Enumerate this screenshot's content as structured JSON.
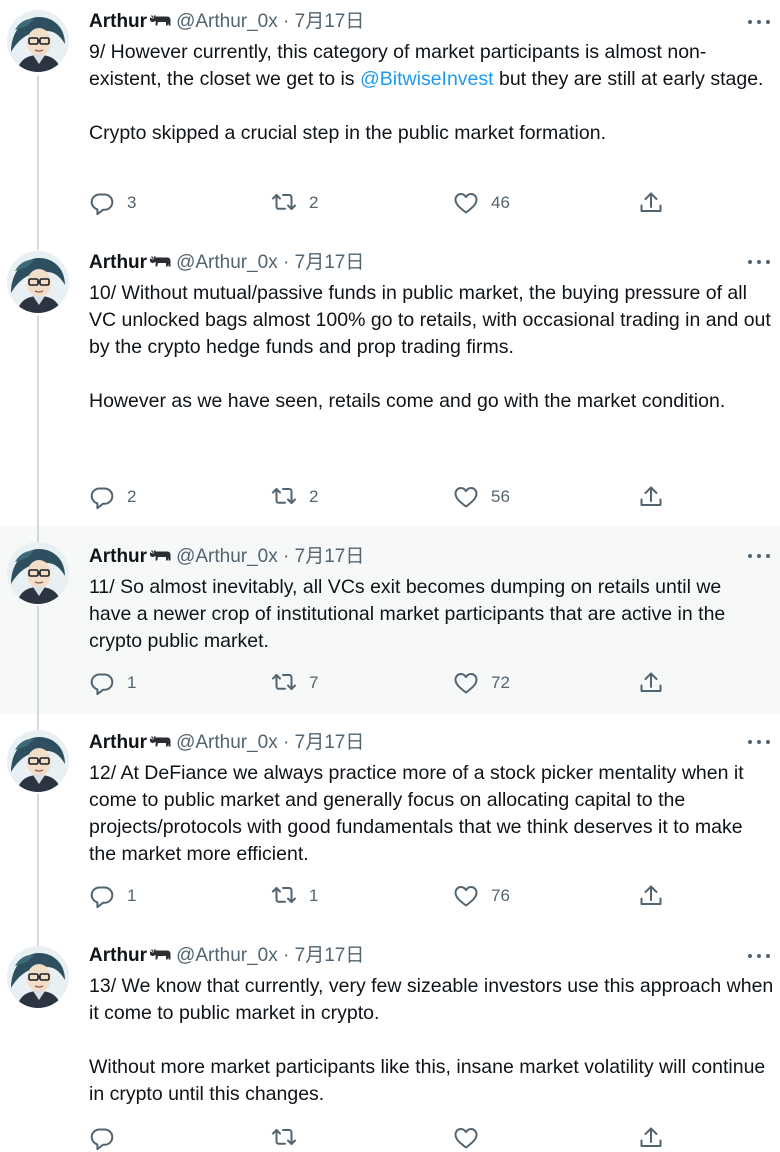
{
  "tweets": [
    {
      "name": "Arthur",
      "handle": "@Arthur_0x",
      "separator": "·",
      "date": "7月17日",
      "text_before": "9/ However currently, this category of market participants is almost non-existent, the closet we get to is ",
      "mention": "@BitwiseInvest",
      "text_after": " but they are still at early stage.\n\nCrypto skipped a crucial step in the public market formation.",
      "replies": "3",
      "retweets": "2",
      "likes": "46"
    },
    {
      "name": "Arthur",
      "handle": "@Arthur_0x",
      "separator": "·",
      "date": "7月17日",
      "text": "10/ Without mutual/passive funds in public market, the buying pressure of all VC unlocked bags almost 100% go to retails, with occasional trading in and out by the crypto hedge funds and prop trading firms.\n\nHowever as we have seen, retails come and go with the market condition.",
      "replies": "2",
      "retweets": "2",
      "likes": "56"
    },
    {
      "name": "Arthur",
      "handle": "@Arthur_0x",
      "separator": "·",
      "date": "7月17日",
      "text": "11/ So almost inevitably, all VCs exit becomes dumping on retails until we  have a newer crop of institutional market participants that are active in the crypto public market.",
      "replies": "1",
      "retweets": "7",
      "likes": "72"
    },
    {
      "name": "Arthur",
      "handle": "@Arthur_0x",
      "separator": "·",
      "date": "7月17日",
      "text": "12/ At DeFiance we always practice more of a stock picker mentality when it come to public market and generally focus on allocating capital to the projects/protocols with good fundamentals that we think deserves it to make the market more efficient.",
      "replies": "1",
      "retweets": "1",
      "likes": "76"
    },
    {
      "name": "Arthur",
      "handle": "@Arthur_0x",
      "separator": "·",
      "date": "7月17日",
      "text": "13/ We know that currently, very few sizeable investors use this approach when it come to public market in crypto.\n\nWithout more market participants like this, insane market volatility will continue in crypto until this changes."
    }
  ],
  "colors": {
    "text": "#0f1419",
    "secondary": "#536471",
    "accent": "#1d9bf0",
    "highlight_bg": "#f7f9f9",
    "thread_line": "#cfd9de"
  },
  "icons": {
    "reply": "comment-bubble-icon",
    "retweet": "retweet-icon",
    "like": "heart-icon",
    "share": "share-upload-icon",
    "more": "more-dots-icon",
    "name_emoji": "bull-emoji-icon"
  }
}
